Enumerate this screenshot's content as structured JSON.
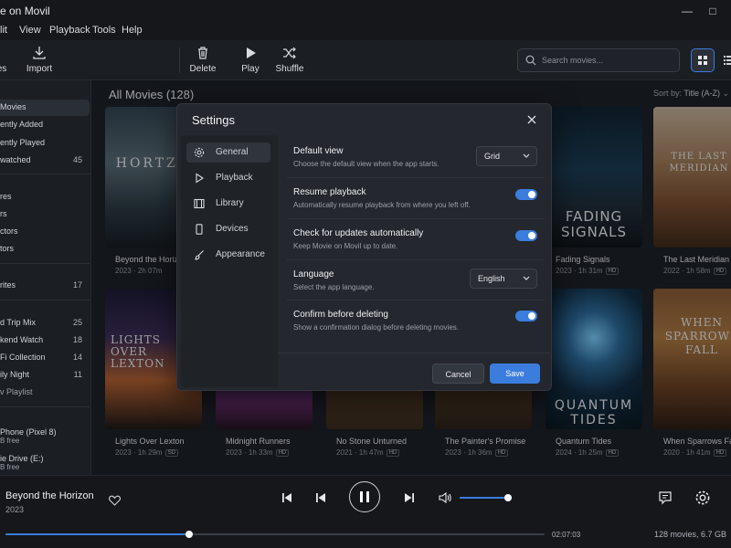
{
  "app": {
    "title": "e on Movil"
  },
  "menu": [
    "lit",
    "View",
    "Playback",
    "Tools",
    "Help"
  ],
  "toolbar": {
    "buttons": [
      "es",
      "Import",
      "Delete",
      "Play",
      "Shuffle"
    ],
    "search_placeholder": "Search movies..."
  },
  "sidebar": {
    "library": [
      {
        "label": "Movies",
        "count": ""
      },
      {
        "label": "ently Added",
        "count": ""
      },
      {
        "label": "ently Played",
        "count": ""
      },
      {
        "label": "watched",
        "count": "45"
      }
    ],
    "browse": [
      "res",
      "rs",
      "ctors",
      "tors"
    ],
    "favorites": {
      "label": "rites",
      "count": "17"
    },
    "playlists": [
      {
        "label": "d Trip Mix",
        "count": "25"
      },
      {
        "label": "kend Watch",
        "count": "18"
      },
      {
        "label": "Fi Collection",
        "count": "14"
      },
      {
        "label": "ily Night",
        "count": "11"
      }
    ],
    "new_playlist": "v Playlist",
    "devices": [
      {
        "label": "Phone (Pixel 8)",
        "sub": "B free"
      },
      {
        "label": "ie Drive (E:)",
        "sub": "B free"
      }
    ]
  },
  "content": {
    "heading": "All Movies (128)",
    "sort_label": "Sort by:",
    "sort_value": "Title (A-Z)"
  },
  "movies": [
    {
      "title": "Beyond the Horizon",
      "year": "2023",
      "duration": "2h 07m",
      "badge": "",
      "poster_text": "HORTZO"
    },
    {
      "title": "Fading Signals",
      "year": "2023",
      "duration": "1h 31m",
      "badge": "HD",
      "poster_text": "FADING SIGNALS"
    },
    {
      "title": "The Last Meridian",
      "year": "2022",
      "duration": "1h 58m",
      "badge": "HD",
      "poster_text": "THE LAST MERIDIAN"
    },
    {
      "title": "Lights Over Lexton",
      "year": "2023",
      "duration": "1h 29m",
      "badge": "SD",
      "poster_text": "LIGHTS OVER LEXTON"
    },
    {
      "title": "Midnight Runners",
      "year": "2023",
      "duration": "1h 33m",
      "badge": "HD",
      "poster_text": ""
    },
    {
      "title": "No Stone Unturned",
      "year": "2021",
      "duration": "1h 47m",
      "badge": "HD",
      "poster_text": ""
    },
    {
      "title": "The Painter's Promise",
      "year": "2023",
      "duration": "1h 36m",
      "badge": "HD",
      "poster_text": ""
    },
    {
      "title": "Quantum Tides",
      "year": "2024",
      "duration": "1h 25m",
      "badge": "HD",
      "poster_text": "QUANTUM TIDES"
    },
    {
      "title": "When Sparrows Fall",
      "year": "2020",
      "duration": "1h 41m",
      "badge": "HD",
      "poster_text": "WHEN SPARROWS FALL"
    }
  ],
  "settings": {
    "title": "Settings",
    "nav": [
      "General",
      "Playback",
      "Library",
      "Devices",
      "Appearance"
    ],
    "items": [
      {
        "name": "Default view",
        "desc": "Choose the default view when the app starts.",
        "control": "select",
        "value": "Grid"
      },
      {
        "name": "Resume playback",
        "desc": "Automatically resume playback from where you left off.",
        "control": "toggle",
        "value": "on"
      },
      {
        "name": "Check for updates automatically",
        "desc": "Keep Movie on Movil up to date.",
        "control": "toggle",
        "value": "on"
      },
      {
        "name": "Language",
        "desc": "Select the app language.",
        "control": "select",
        "value": "English"
      },
      {
        "name": "Confirm before deleting",
        "desc": "Show a confirmation dialog before deleting movies.",
        "control": "toggle",
        "value": "on"
      }
    ],
    "cancel_label": "Cancel",
    "save_label": "Save"
  },
  "player": {
    "title": "Beyond the Horizon",
    "year": "2023",
    "time": "02:07:03",
    "progress": 0.34,
    "volume": 0.95,
    "status": "128 movies, 6.7 GB"
  },
  "colors": {
    "accent": "#3b7ddd",
    "background": "#1a1d22",
    "panel": "#24272d"
  }
}
